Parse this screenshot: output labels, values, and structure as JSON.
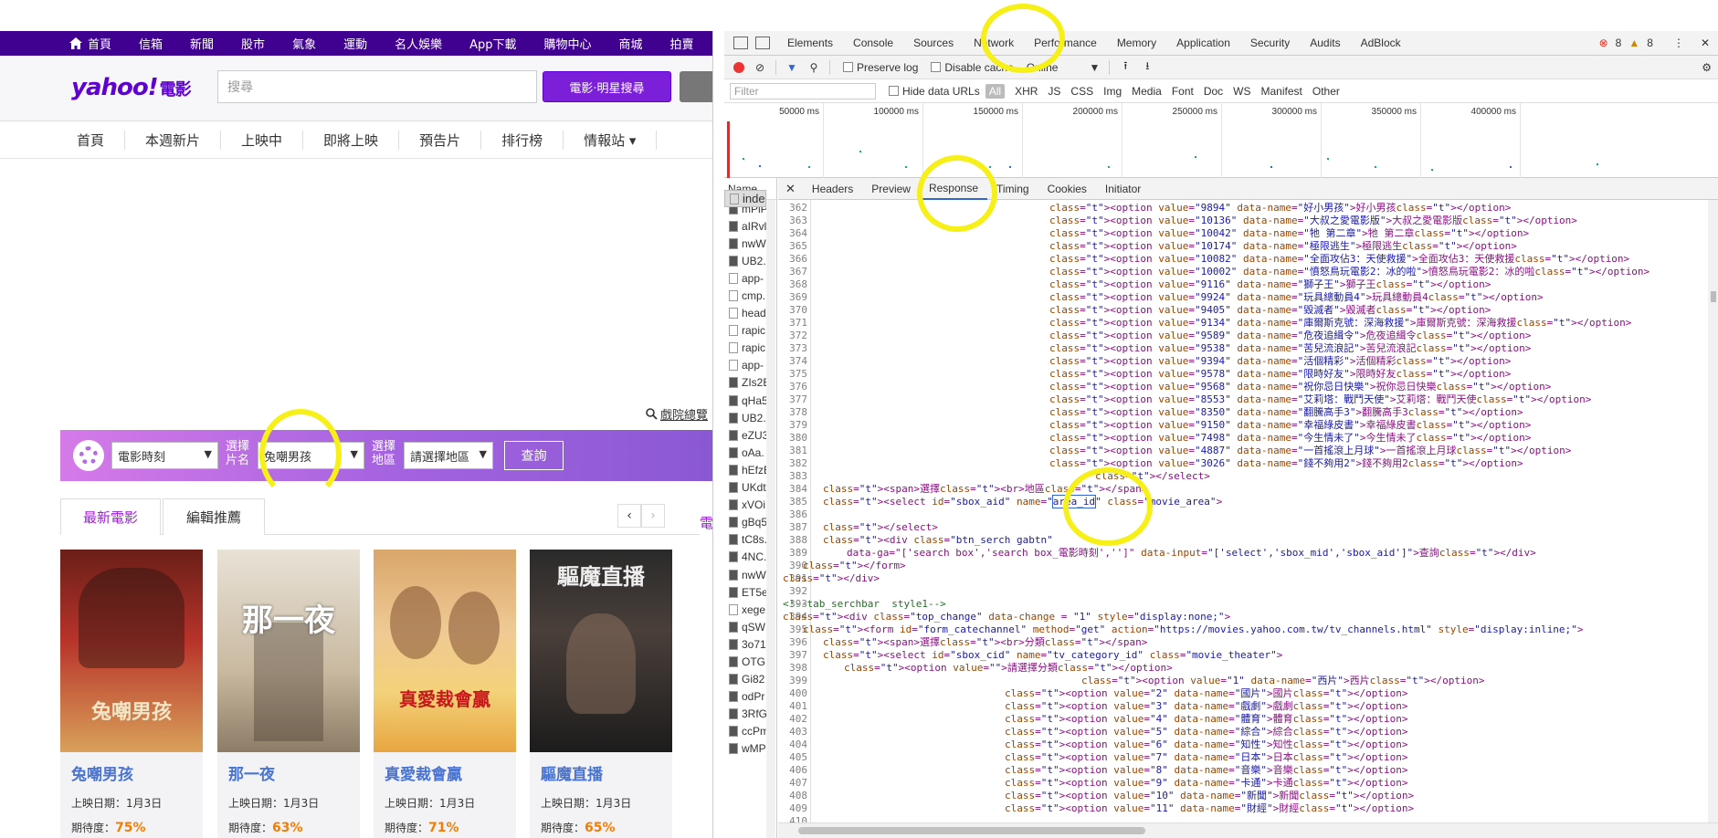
{
  "yahoo": {
    "topbar_items": [
      "首頁",
      "信箱",
      "新聞",
      "股市",
      "氣象",
      "運動",
      "名人娛樂",
      "App下載",
      "購物中心",
      "商城",
      "拍賣"
    ],
    "logo": "yahoo!",
    "logo_sub": "電影",
    "search_placeholder": "搜尋",
    "search_button": "電影‧明星搜尋",
    "nav_items": [
      "首頁",
      "本週新片",
      "上映中",
      "即將上映",
      "預告片",
      "排行榜",
      "情報站 ▾"
    ],
    "theater_link": "戲院總覽",
    "searchbar": {
      "select_type": "電影時刻",
      "label_movie": "選擇\n片名",
      "select_movie": "兔嘲男孩",
      "label_area": "選擇\n地區",
      "select_area": "請選擇地區",
      "query_button": "查詢"
    },
    "tabs": [
      "最新電影",
      "編輯推薦"
    ],
    "side_tab": "電",
    "pager_prev": "‹",
    "pager_next": "›",
    "cards": [
      {
        "poster_title": "兔嘲男孩",
        "title": "兔嘲男孩",
        "date": "上映日期：1月3日",
        "exp_label": "期待度：",
        "exp": "75%"
      },
      {
        "poster_title": "那一夜",
        "title": "那一夜",
        "date": "上映日期：1月3日",
        "exp_label": "期待度：",
        "exp": "63%"
      },
      {
        "poster_title": "真愛裁會贏",
        "title": "真愛裁會贏",
        "date": "上映日期：1月3日",
        "exp_label": "期待度：",
        "exp": "71%"
      },
      {
        "poster_title": "驅魔直播",
        "title": "驅魔直播",
        "date": "上映日期：1月3日",
        "exp_label": "期待度：",
        "exp": "65%"
      }
    ]
  },
  "devtools": {
    "tabs": [
      "Elements",
      "Console",
      "Sources",
      "Network",
      "Performance",
      "Memory",
      "Application",
      "Security",
      "Audits",
      "AdBlock"
    ],
    "errors": "8",
    "warnings": "8",
    "toolbar": {
      "preserve_log": "Preserve log",
      "disable_cache": "Disable cache",
      "throttle": "Online"
    },
    "filter_placeholder": "Filter",
    "hide_data_urls": "Hide data URLs",
    "filter_types": [
      "All",
      "XHR",
      "JS",
      "CSS",
      "Img",
      "Media",
      "Font",
      "Doc",
      "WS",
      "Manifest",
      "Other"
    ],
    "timeline_ticks": [
      "50000 ms",
      "100000 ms",
      "150000 ms",
      "200000 ms",
      "250000 ms",
      "300000 ms",
      "350000 ms",
      "400000 ms"
    ],
    "name_header": "Name",
    "requests": [
      "inde",
      "mPiP",
      "aIRvl",
      "nwW",
      "UB2.",
      "app-",
      "cmp.",
      "head",
      "rapic",
      "rapic",
      "app-",
      "ZIs2E",
      "qHa5",
      "UB2.",
      "eZU3",
      "oAa.",
      "hEfzE",
      "UKdt",
      "xVOi",
      "gBq5",
      "tC8s.",
      "4NC.",
      "nwW",
      "ET5e",
      "xege",
      "qSW",
      "3o71",
      "OTG.",
      "Gi82",
      "odPr",
      "3RfG",
      "ccPm",
      "wMP"
    ],
    "response_tabs": [
      "Headers",
      "Preview",
      "Response",
      "Timing",
      "Cookies",
      "Initiator"
    ],
    "code_lines": [
      {
        "n": "362",
        "text": "<option value=\"9894\" data-name=\"好小男孩\">好小男孩</option>"
      },
      {
        "n": "363",
        "text": "<option value=\"10136\" data-name=\"大叔之愛電影版\">大叔之愛電影版</option>"
      },
      {
        "n": "364",
        "text": "<option value=\"10042\" data-name=\"牠 第二章\">牠 第二章</option>"
      },
      {
        "n": "365",
        "text": "<option value=\"10174\" data-name=\"極限逃生\">極限逃生</option>"
      },
      {
        "n": "366",
        "text": "<option value=\"10082\" data-name=\"全面攻佔3：天使救援\">全面攻佔3：天使救援</option>"
      },
      {
        "n": "367",
        "text": "<option value=\"10002\" data-name=\"憤怒鳥玩電影2：冰的啦\">憤怒鳥玩電影2：冰的啦</option>"
      },
      {
        "n": "368",
        "text": "<option value=\"9116\" data-name=\"獅子王\">獅子王</option>"
      },
      {
        "n": "369",
        "text": "<option value=\"9924\" data-name=\"玩具總動員4\">玩具總動員4</option>"
      },
      {
        "n": "370",
        "text": "<option value=\"9405\" data-name=\"毀滅者\">毀滅者</option>"
      },
      {
        "n": "371",
        "text": "<option value=\"9134\" data-name=\"庫爾斯克號：深海救援\">庫爾斯克號：深海救援</option>"
      },
      {
        "n": "372",
        "text": "<option value=\"9589\" data-name=\"危夜追緝令\">危夜追緝令</option>"
      },
      {
        "n": "373",
        "text": "<option value=\"9538\" data-name=\"苦兒流浪記\">苦兒流浪記</option>"
      },
      {
        "n": "374",
        "text": "<option value=\"9394\" data-name=\"活個精彩\">活個精彩</option>"
      },
      {
        "n": "375",
        "text": "<option value=\"9578\" data-name=\"限時好友\">限時好友</option>"
      },
      {
        "n": "376",
        "text": "<option value=\"9568\" data-name=\"祝你忌日快樂\">祝你忌日快樂</option>"
      },
      {
        "n": "377",
        "text": "<option value=\"8553\" data-name=\"艾莉塔：戰鬥天使\">艾莉塔：戰鬥天使</option>"
      },
      {
        "n": "378",
        "text": "<option value=\"8350\" data-name=\"翻騰高手3\">翻騰高手3</option>"
      },
      {
        "n": "379",
        "text": "<option value=\"9150\" data-name=\"幸福綠皮書\">幸福綠皮書</option>"
      },
      {
        "n": "380",
        "text": "<option value=\"7498\" data-name=\"今生情未了\">今生情未了</option>"
      },
      {
        "n": "381",
        "text": "<option value=\"4887\" data-name=\"一首搖滾上月球\">一首搖滾上月球</option>"
      },
      {
        "n": "382",
        "text": "<option value=\"3026\" data-name=\"錢不夠用2\">錢不夠用2</option>"
      },
      {
        "n": "383",
        "text": "</select>"
      },
      {
        "n": "384",
        "text": "<span>選擇<br>地區</span>"
      },
      {
        "n": "385",
        "text": "<select id=\"sbox_aid\" name=\"area_id\" class=\"movie_area\">"
      },
      {
        "n": "386",
        "text": ""
      },
      {
        "n": "387",
        "text": "</select>"
      },
      {
        "n": "388",
        "text": "<div class=\"btn_serch gabtn\""
      },
      {
        "n": "389",
        "text": "data-ga=\"['search box','search box_電影時刻','']\" data-input=\"['select','sbox_mid','sbox_aid']\">查詢</div>"
      },
      {
        "n": "390",
        "text": "</form>"
      },
      {
        "n": "391",
        "text": "</div>"
      },
      {
        "n": "392",
        "text": ""
      },
      {
        "n": "393",
        "text": "<!--tab_serchbar  style1-->"
      },
      {
        "n": "394",
        "text": "<div class=\"top_change\" data-change = \"1\" style=\"display:none;\">"
      },
      {
        "n": "395",
        "text": "<form id=\"form_catechannel\" method=\"get\" action=\"https://movies.yahoo.com.tw/tv_channels.html\" style=\"display:inline;\">"
      },
      {
        "n": "396",
        "text": "<span>選擇<br>分類</span>"
      },
      {
        "n": "397",
        "text": "<select id=\"sbox_cid\" name=\"tv_category_id\" class=\"movie_theater\">"
      },
      {
        "n": "398",
        "text": "<option value=\"\">請選擇分類</option>"
      },
      {
        "n": "399",
        "text": "<option value=\"1\" data-name=\"西片\">西片</option>"
      },
      {
        "n": "400",
        "text": "<option value=\"2\" data-name=\"國片\">國片</option>"
      },
      {
        "n": "401",
        "text": "<option value=\"3\" data-name=\"戲劇\">戲劇</option>"
      },
      {
        "n": "402",
        "text": "<option value=\"4\" data-name=\"體育\">體育</option>"
      },
      {
        "n": "403",
        "text": "<option value=\"5\" data-name=\"綜合\">綜合</option>"
      },
      {
        "n": "404",
        "text": "<option value=\"6\" data-name=\"知性\">知性</option>"
      },
      {
        "n": "405",
        "text": "<option value=\"7\" data-name=\"日本\">日本</option>"
      },
      {
        "n": "406",
        "text": "<option value=\"8\" data-name=\"音樂\">音樂</option>"
      },
      {
        "n": "407",
        "text": "<option value=\"9\" data-name=\"卡通\">卡通</option>"
      },
      {
        "n": "408",
        "text": "<option value=\"10\" data-name=\"新聞\">新聞</option>"
      },
      {
        "n": "409",
        "text": "<option value=\"11\" data-name=\"財經\">財經</option>"
      },
      {
        "n": "410",
        "text": ""
      }
    ]
  }
}
